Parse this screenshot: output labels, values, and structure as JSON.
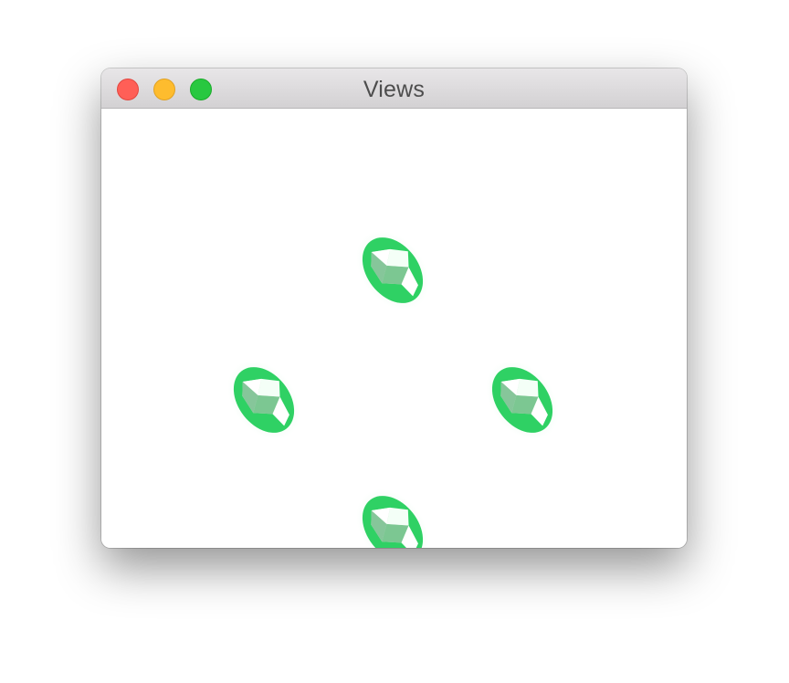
{
  "window": {
    "title": "Views"
  },
  "traffic_lights": {
    "close_color": "#ff5f57",
    "minimize_color": "#febc2e",
    "zoom_color": "#28c840"
  },
  "gems": {
    "count": 4,
    "color": "#2ed164",
    "items": [
      "top",
      "left",
      "right",
      "bottom"
    ]
  }
}
